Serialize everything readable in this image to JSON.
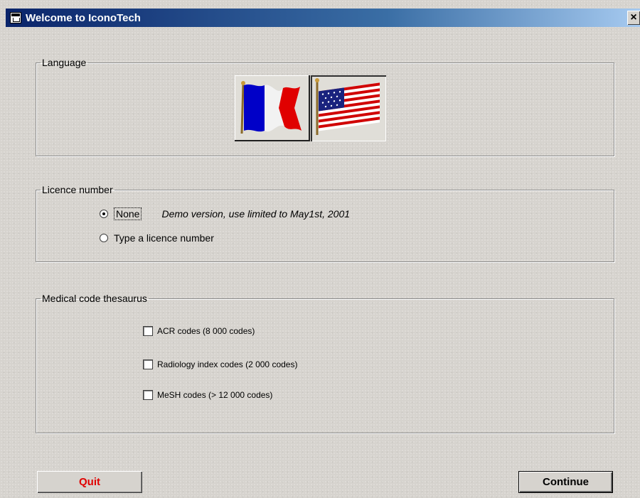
{
  "window": {
    "title": "Welcome to IconoTech",
    "close_glyph": "×"
  },
  "language": {
    "legend": "Language",
    "options": [
      {
        "icon": "french-flag-icon",
        "colors": [
          "#0000c8",
          "#ffffff",
          "#e00000"
        ]
      },
      {
        "icon": "american-flag-icon",
        "colors": [
          "#1a237e",
          "#ffffff",
          "#d00000"
        ]
      }
    ]
  },
  "licence": {
    "legend": "Licence number",
    "option_none": "None",
    "demo_note": "Demo version, use limited to May1st, 2001",
    "option_type": "Type a licence number"
  },
  "thesaurus": {
    "legend": "Medical code thesaurus",
    "items": [
      {
        "label": "ACR  codes (8 000 codes)",
        "checked": false
      },
      {
        "label": "Radiology  index codes (2 000 codes)",
        "checked": false
      },
      {
        "label": "MeSH codes (> 12 000 codes)",
        "checked": false
      }
    ]
  },
  "buttons": {
    "quit": "Quit",
    "continue": "Continue"
  },
  "colors": {
    "titlebar_start": "#0a246a",
    "titlebar_end": "#a6caf0",
    "quit_text": "#e00000",
    "panel_bg": "#d6d3ce"
  }
}
